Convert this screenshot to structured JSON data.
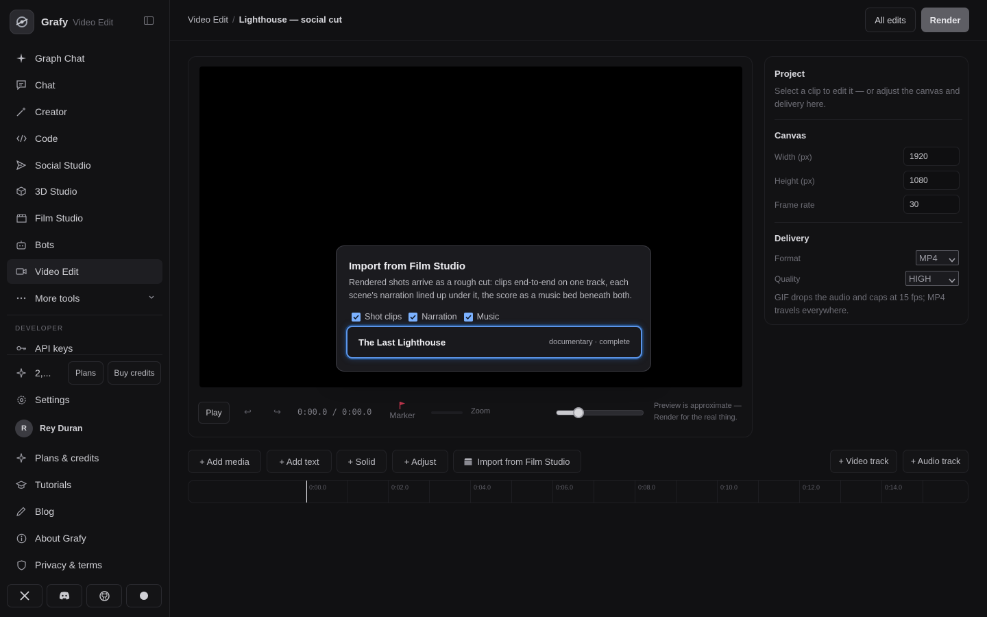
{
  "brand": {
    "name": "Grafy",
    "sub": "Video Edit"
  },
  "nav": [
    {
      "label": "Graph Chat",
      "icon": "sparkle-icon"
    },
    {
      "label": "Chat",
      "icon": "chat-icon"
    },
    {
      "label": "Creator",
      "icon": "wand-icon"
    },
    {
      "label": "Code",
      "icon": "code-icon"
    },
    {
      "label": "Social Studio",
      "icon": "send-icon"
    },
    {
      "label": "3D Studio",
      "icon": "cube-icon"
    },
    {
      "label": "Film Studio",
      "icon": "clapper-icon"
    },
    {
      "label": "Bots",
      "icon": "bot-icon"
    },
    {
      "label": "Video Edit",
      "icon": "video-icon"
    },
    {
      "label": "More tools",
      "icon": "more-icon"
    }
  ],
  "developer": {
    "section": "DEVELOPER",
    "api_keys": "API keys"
  },
  "credits": {
    "count": "2,...",
    "plans": "Plans",
    "buy": "Buy credits"
  },
  "lower_nav": {
    "settings": "Settings",
    "user_initial": "R",
    "user_name": "Rey Duran",
    "plans_credits": "Plans & credits",
    "tutorials": "Tutorials",
    "blog": "Blog",
    "about": "About Grafy",
    "privacy": "Privacy & terms"
  },
  "header": {
    "crumb_root": "Video Edit",
    "crumb_sep": "/",
    "crumb_current": "Lighthouse — social cut",
    "all_edits": "All edits",
    "render": "Render"
  },
  "preview": {
    "play": "Play",
    "undo": "↩",
    "redo": "↪",
    "time": "0:00.0 / 0:00.0",
    "marker": "Marker",
    "zoom": "Zoom",
    "zoom_level": 0.25,
    "note": "Preview is approximate — Render for the real thing."
  },
  "dialog": {
    "title": "Import from Film Studio",
    "description": "Rendered shots arrive as a rough cut: clips end-to-end on one track, each scene's narration lined up under it, the score as a music bed beneath both.",
    "options": [
      {
        "label": "Shot clips",
        "checked": true
      },
      {
        "label": "Narration",
        "checked": true
      },
      {
        "label": "Music",
        "checked": true
      }
    ],
    "film": {
      "name": "The Last Lighthouse",
      "meta": "documentary · complete"
    }
  },
  "project": {
    "title": "Project",
    "description": "Select a clip to edit it — or adjust the canvas and delivery here.",
    "canvas_title": "Canvas",
    "width_label": "Width (px)",
    "width": "1920",
    "height_label": "Height (px)",
    "height": "1080",
    "fps_label": "Frame rate",
    "fps": "30",
    "delivery_title": "Delivery",
    "format_label": "Format",
    "format": "MP4",
    "quality_label": "Quality",
    "quality": "HIGH",
    "delivery_note": "GIF drops the audio and caps at 15 fps; MP4 travels everywhere."
  },
  "toolbar": {
    "add_media": "+  Add media",
    "add_text": "+  Add text",
    "solid": "+  Solid",
    "adjust": "+  Adjust",
    "import": "Import from Film Studio",
    "video_track": "+  Video track",
    "audio_track": "+  Audio track"
  },
  "timeline": {
    "labels": [
      "0:00.0",
      "0:02.0",
      "0:04.0",
      "0:06.0",
      "0:08.0",
      "0:10.0",
      "0:12.0",
      "0:14.0"
    ]
  }
}
